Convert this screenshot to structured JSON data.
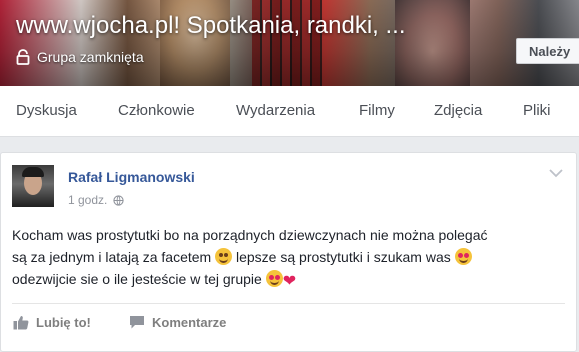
{
  "cover": {
    "title": "www.wjocha.pl! Spotkania, randki, ...",
    "privacy_label": "Grupa zamknięta",
    "join_label": "Należy"
  },
  "tabs": [
    {
      "label": "Dyskusja"
    },
    {
      "label": "Członkowie"
    },
    {
      "label": "Wydarzenia"
    },
    {
      "label": "Filmy"
    },
    {
      "label": "Zdjęcia"
    },
    {
      "label": "Pliki"
    }
  ],
  "post": {
    "author": "Rafał Ligmanowski",
    "time": "1 godz.",
    "line1": "Kocham was prostytutki bo na porządnych dziewczynach nie można polegać",
    "line2a": "są za jednym i latają za facetem",
    "line2b": "lepsze są prostytutki i szukam was",
    "line3": "odezwijcie sie o ile jesteście w tej grupie",
    "like_label": "Lubię to!",
    "comment_label": "Komentarze"
  },
  "icons": {
    "lock": "lock-icon",
    "globe": "globe-icon",
    "chevron": "chevron-down-icon",
    "like": "thumbs-up-icon",
    "comment": "comment-icon"
  },
  "colors": {
    "link": "#365899",
    "muted": "#90949c",
    "background": "#e9ebee"
  }
}
